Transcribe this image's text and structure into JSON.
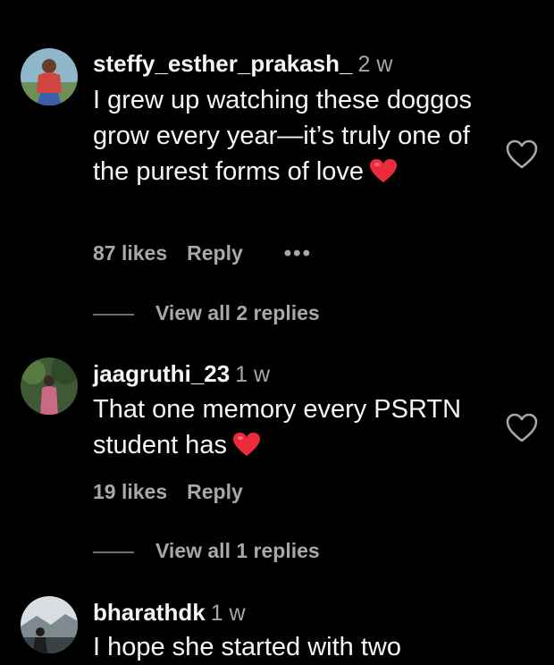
{
  "comments": [
    {
      "username": "steffy_esther_prakash_",
      "time": "2 w",
      "text": "I grew up watching these doggos grow every year—it’s truly one of the purest forms of love",
      "likes": "87 likes",
      "reply_label": "Reply",
      "more_label": "•••",
      "view_replies": "View all 2 replies"
    },
    {
      "username": "jaagruthi_23",
      "time": "1 w",
      "text": "That one memory every PSRTN student has",
      "likes": "19 likes",
      "reply_label": "Reply",
      "view_replies": "View all 1 replies"
    },
    {
      "username": "bharathdk",
      "time": "1 w",
      "text": "I hope she started with two"
    }
  ],
  "colors": {
    "background": "#000000",
    "primary_text": "#f5f5f5",
    "secondary_text": "#a8a8a8",
    "heart_red": "#ed2a3c"
  },
  "icons": {
    "like": "heart-outline-icon",
    "emoji": "red-heart-emoji-icon"
  }
}
